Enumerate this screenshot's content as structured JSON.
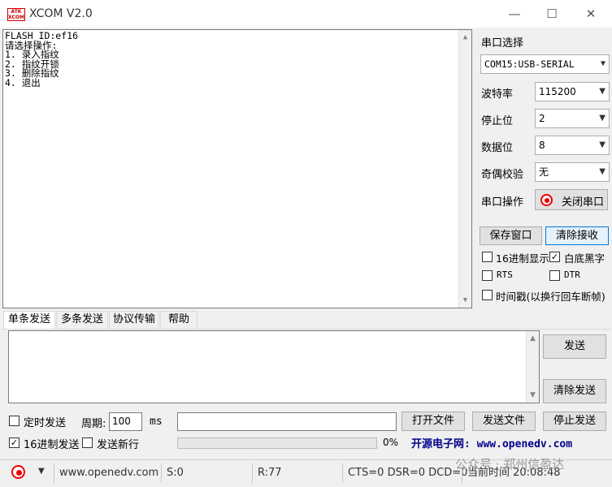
{
  "window": {
    "title": "XCOM V2.0",
    "icon_text": "ATK\nXCOM",
    "minimize": "—",
    "maximize": "☐",
    "close": "✕"
  },
  "receive": {
    "lines": [
      "FLASH_ID:ef16",
      "请选择操作:",
      "1. 录入指纹",
      "2. 指纹开锁",
      "3. 删除指纹",
      "4. 退出"
    ]
  },
  "settings": {
    "port_label": "串口选择",
    "port_value": "COM15:USB-SERIAL",
    "baud_label": "波特率",
    "baud_value": "115200",
    "stop_label": "停止位",
    "stop_value": "2",
    "data_label": "数据位",
    "data_value": "8",
    "parity_label": "奇偶校验",
    "parity_value": "无",
    "op_label": "串口操作",
    "op_button": "关闭串口",
    "save_window": "保存窗口",
    "clear_receive": "清除接收",
    "hex_display": "16进制显示",
    "hex_display_checked": false,
    "white_bg": "白底黑字",
    "white_bg_checked": true,
    "rts": "RTS",
    "rts_checked": false,
    "dtr": "DTR",
    "dtr_checked": false,
    "timestamp": "时间戳(以换行回车断帧)",
    "timestamp_checked": false
  },
  "tabs": [
    "单条发送",
    "多条发送",
    "协议传输",
    "帮助"
  ],
  "send": {
    "text": "",
    "send_button": "发送",
    "clear_send_button": "清除发送",
    "timed_send": "定时发送",
    "timed_send_checked": false,
    "period_label": "周期:",
    "period_value": "100",
    "period_unit": "ms",
    "open_file": "打开文件",
    "send_file": "发送文件",
    "stop_send": "停止发送",
    "hex_send": "16进制发送",
    "hex_send_checked": true,
    "send_newline": "发送新行",
    "send_newline_checked": false,
    "progress_percent": "0%",
    "promo": "开源电子网: www.openedv.com",
    "file_path": ""
  },
  "status": {
    "website": "www.openedv.com",
    "sent": "S:0",
    "received": "R:77",
    "lines": "CTS=0 DSR=0 DCD=0",
    "time": "当前时间 20:08:48",
    "watermark": "公众号 · 郑州信盈达"
  },
  "colors": {
    "accent": "#0078d7",
    "red": "#e00000",
    "link": "#00008b"
  }
}
